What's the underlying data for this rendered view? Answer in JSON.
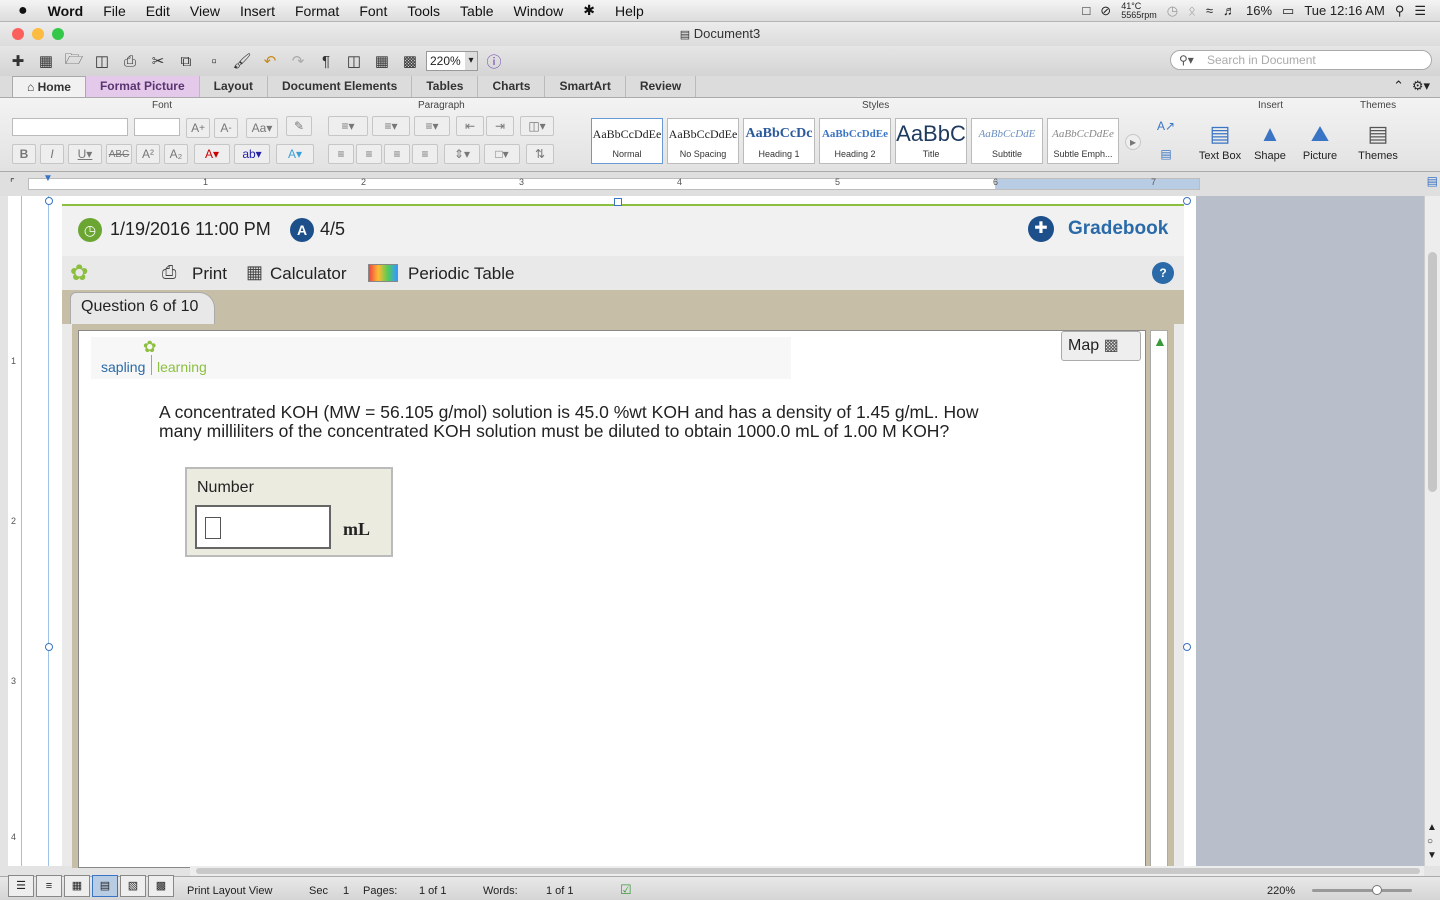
{
  "menubar": {
    "apple": "",
    "items": [
      "Word",
      "File",
      "Edit",
      "View",
      "Insert",
      "Format",
      "Font",
      "Tools",
      "Table",
      "Window",
      "Help"
    ],
    "temp": "41°C",
    "rpm": "5565rpm",
    "battery": "16%",
    "clock": "Tue 12:16 AM"
  },
  "window": {
    "title": "Document3"
  },
  "toolbar": {
    "zoom": "220%",
    "search_placeholder": "Search in Document"
  },
  "ribbon_tabs": [
    "Home",
    "Format Picture",
    "Layout",
    "Document Elements",
    "Tables",
    "Charts",
    "SmartArt",
    "Review"
  ],
  "ribbon": {
    "groups": {
      "font": "Font",
      "paragraph": "Paragraph",
      "styles": "Styles",
      "insert": "Insert",
      "themes": "Themes"
    },
    "styles": [
      {
        "sample": "AaBbCcDdEe",
        "name": "Normal"
      },
      {
        "sample": "AaBbCcDdEe",
        "name": "No Spacing"
      },
      {
        "sample": "AaBbCcDc",
        "name": "Heading 1"
      },
      {
        "sample": "AaBbCcDdEe",
        "name": "Heading 2"
      },
      {
        "sample": "AaBbC",
        "name": "Title"
      },
      {
        "sample": "AaBbCcDdE",
        "name": "Subtitle"
      },
      {
        "sample": "AaBbCcDdEe",
        "name": "Subtle Emph..."
      }
    ],
    "insert": [
      "Text Box",
      "Shape",
      "Picture"
    ],
    "themes": "Themes"
  },
  "ruler": {
    "marks": [
      "1",
      "2",
      "3",
      "4",
      "5",
      "6",
      "7"
    ],
    "vmarks": [
      "1",
      "2",
      "3",
      "4"
    ]
  },
  "picture": {
    "datetime": "1/19/2016 11:00 PM",
    "score": "4/5",
    "gradebook": "Gradebook",
    "tools": [
      "Print",
      "Calculator",
      "Periodic Table"
    ],
    "question_tab": "Question 6 of 10",
    "map_label": "Map",
    "logo_left": "sapling",
    "logo_right": "learning",
    "question_line1": "A concentrated KOH (MW = 56.105 g/mol) solution is 45.0 %wt KOH and has a density of 1.45 g/mL. How",
    "question_line2": "many milliliters of the concentrated KOH solution must be diluted to obtain 1000.0 mL of 1.00 M KOH?",
    "answer_label": "Number",
    "answer_value": "",
    "unit": "mL"
  },
  "status": {
    "view": "Print Layout View",
    "sec_label": "Sec",
    "sec": "1",
    "pages_label": "Pages:",
    "pages": "1 of 1",
    "words_label": "Words:",
    "words": "1 of 1",
    "zoom": "220%"
  },
  "colors": {
    "accent": "#2a6aa8",
    "green": "#8cbf3f",
    "tan": "#c7bea8",
    "purple_tab": "#e4c9ea"
  }
}
